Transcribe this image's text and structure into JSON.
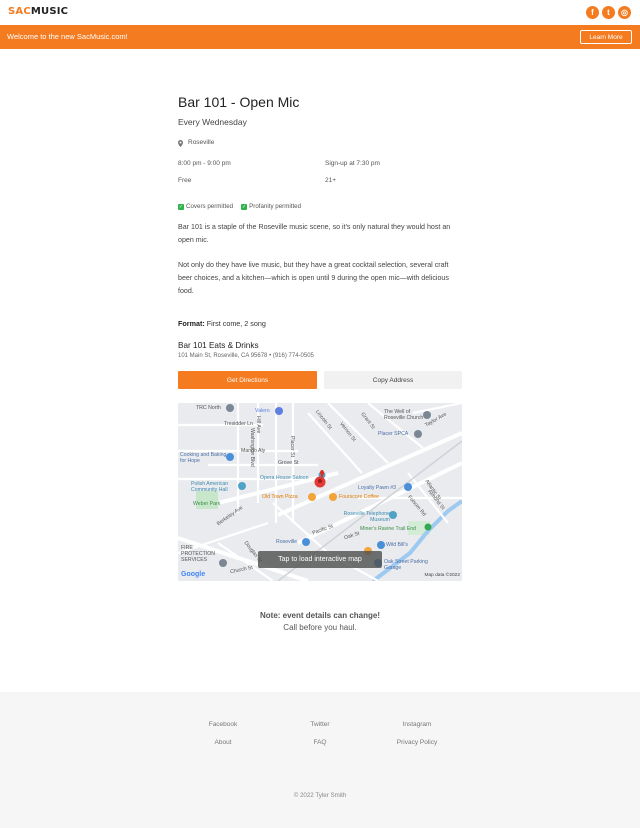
{
  "header": {
    "logo_part1": "SAC",
    "logo_part2": "MUSIC",
    "socials": [
      {
        "icon": "facebook-icon",
        "glyph": "f"
      },
      {
        "icon": "twitter-icon",
        "glyph": "t"
      },
      {
        "icon": "instagram-icon",
        "glyph": "◎"
      }
    ]
  },
  "banner": {
    "text": "Welcome to the new SacMusic.com!",
    "button_label": "Learn More"
  },
  "event": {
    "title": "Bar 101 - Open Mic",
    "schedule": "Every Wednesday",
    "location": "Roseville",
    "time": "8:00 pm - 9:00 pm",
    "signup": "Sign-up at 7:30 pm",
    "price": "Free",
    "age": "21+",
    "badges": [
      "Covers permitted",
      "Profanity permitted"
    ],
    "description_1": "Bar 101 is a staple of the Roseville music scene, so it's only natural they would host an open mic.",
    "description_2": "Not only do they have live music, but they have a great cocktail selection, several craft beer choices, and a kitchen—which is open until 9 during the open mic—with delicious food.",
    "format_label": "Format:",
    "format_value": "First come, 2 song",
    "venue_name": "Bar 101 Eats & Drinks",
    "venue_address": "101 Main St, Roseville, CA 95678",
    "venue_separator": "•",
    "venue_phone": "(916) 774-0505",
    "directions_label": "Get Directions",
    "copy_label": "Copy Address"
  },
  "map": {
    "overlay_text": "Tap to load interactive map",
    "google_label": "Google",
    "map_data_label": "Map data ©2022",
    "labels": [
      "TRC North",
      "Valero",
      "The Well of Roseville Church",
      "Tresidder Ln",
      "Lincoln St",
      "Placer SPCA",
      "Mango Aly",
      "Cooking and Baking for Hope",
      "Grove St",
      "Opera House Saloon",
      "Polish American Community Hall",
      "Old Town Pizza",
      "Fourscore Coffee",
      "Loyalty Pawn #3",
      "Weber Park",
      "Roseville Telephone Museum",
      "Miner's Ravine Trail End",
      "Roseville",
      "Wild Bill's",
      "FIRE PROTECTION SERVICES",
      "Oak Street Parking Garage",
      "Church St",
      "Pacific St",
      "Berkeley Ave",
      "Washington Blvd",
      "Placer St",
      "Atlantic St",
      "Vernon St",
      "Folsom Rd",
      "Taylor Ave",
      "Grant St",
      "Oak St",
      "Hill Ave",
      "Douglas St",
      "Almond St"
    ]
  },
  "notice": {
    "line1": "Note: event details can change!",
    "line2": "Call before you haul."
  },
  "footer": {
    "links": [
      "Facebook",
      "Twitter",
      "Instagram",
      "About",
      "FAQ",
      "Privacy Policy"
    ],
    "copyright": "© 2022 Tyler Smith"
  }
}
